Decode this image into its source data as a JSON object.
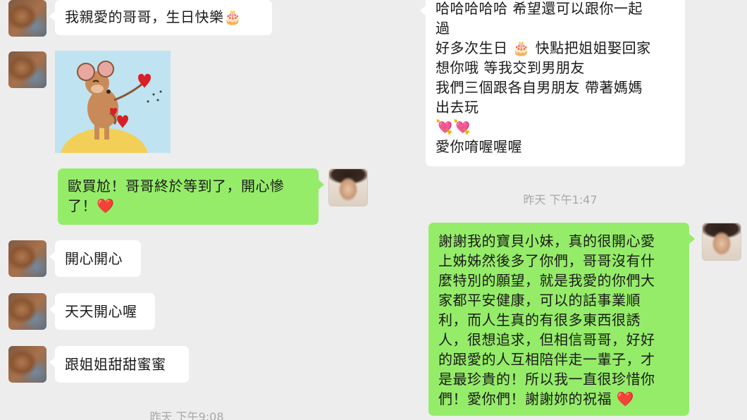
{
  "left_panel": {
    "messages": [
      {
        "text": "我親愛的哥哥，生日快樂🎂"
      },
      {
        "sticker": "jerry-mouse-hearts-sticker"
      },
      {
        "lines": [
          "歐買尬！哥哥終於等到了，開心慘",
          "了！❤️"
        ]
      },
      {
        "text": "開心開心"
      },
      {
        "text": "天天開心喔"
      },
      {
        "text": "跟姐姐甜甜蜜蜜"
      }
    ],
    "timestamp": "昨天 下午9:08"
  },
  "right_panel": {
    "incoming_lines": [
      "哈哈哈哈哈 希望還可以跟你一起",
      "過",
      "好多次生日 🎂 快點把姐姐娶回家",
      "想你哦 等我交到男朋友",
      "我們三個跟各自男朋友 帶著媽媽",
      "出去玩",
      "💘💘",
      "愛你唷喔喔喔"
    ],
    "timestamp": "昨天 下午1:47",
    "outgoing_lines": [
      "謝謝我的寶貝小妹，真的很開心愛",
      "上姊姊然後多了你們，哥哥沒有什",
      "麼特別的願望，就是我愛的你們大",
      "家都平安健康，可以的話事業順",
      "利，而人生真的有很多東西很誘",
      "人，很想追求，但相信哥哥，好好",
      "的跟愛的人互相陪伴走一輩子，才",
      "是最珍貴的！所以我一直很珍惜你",
      "們！愛你們！謝謝妳的祝福 ❤️"
    ]
  }
}
